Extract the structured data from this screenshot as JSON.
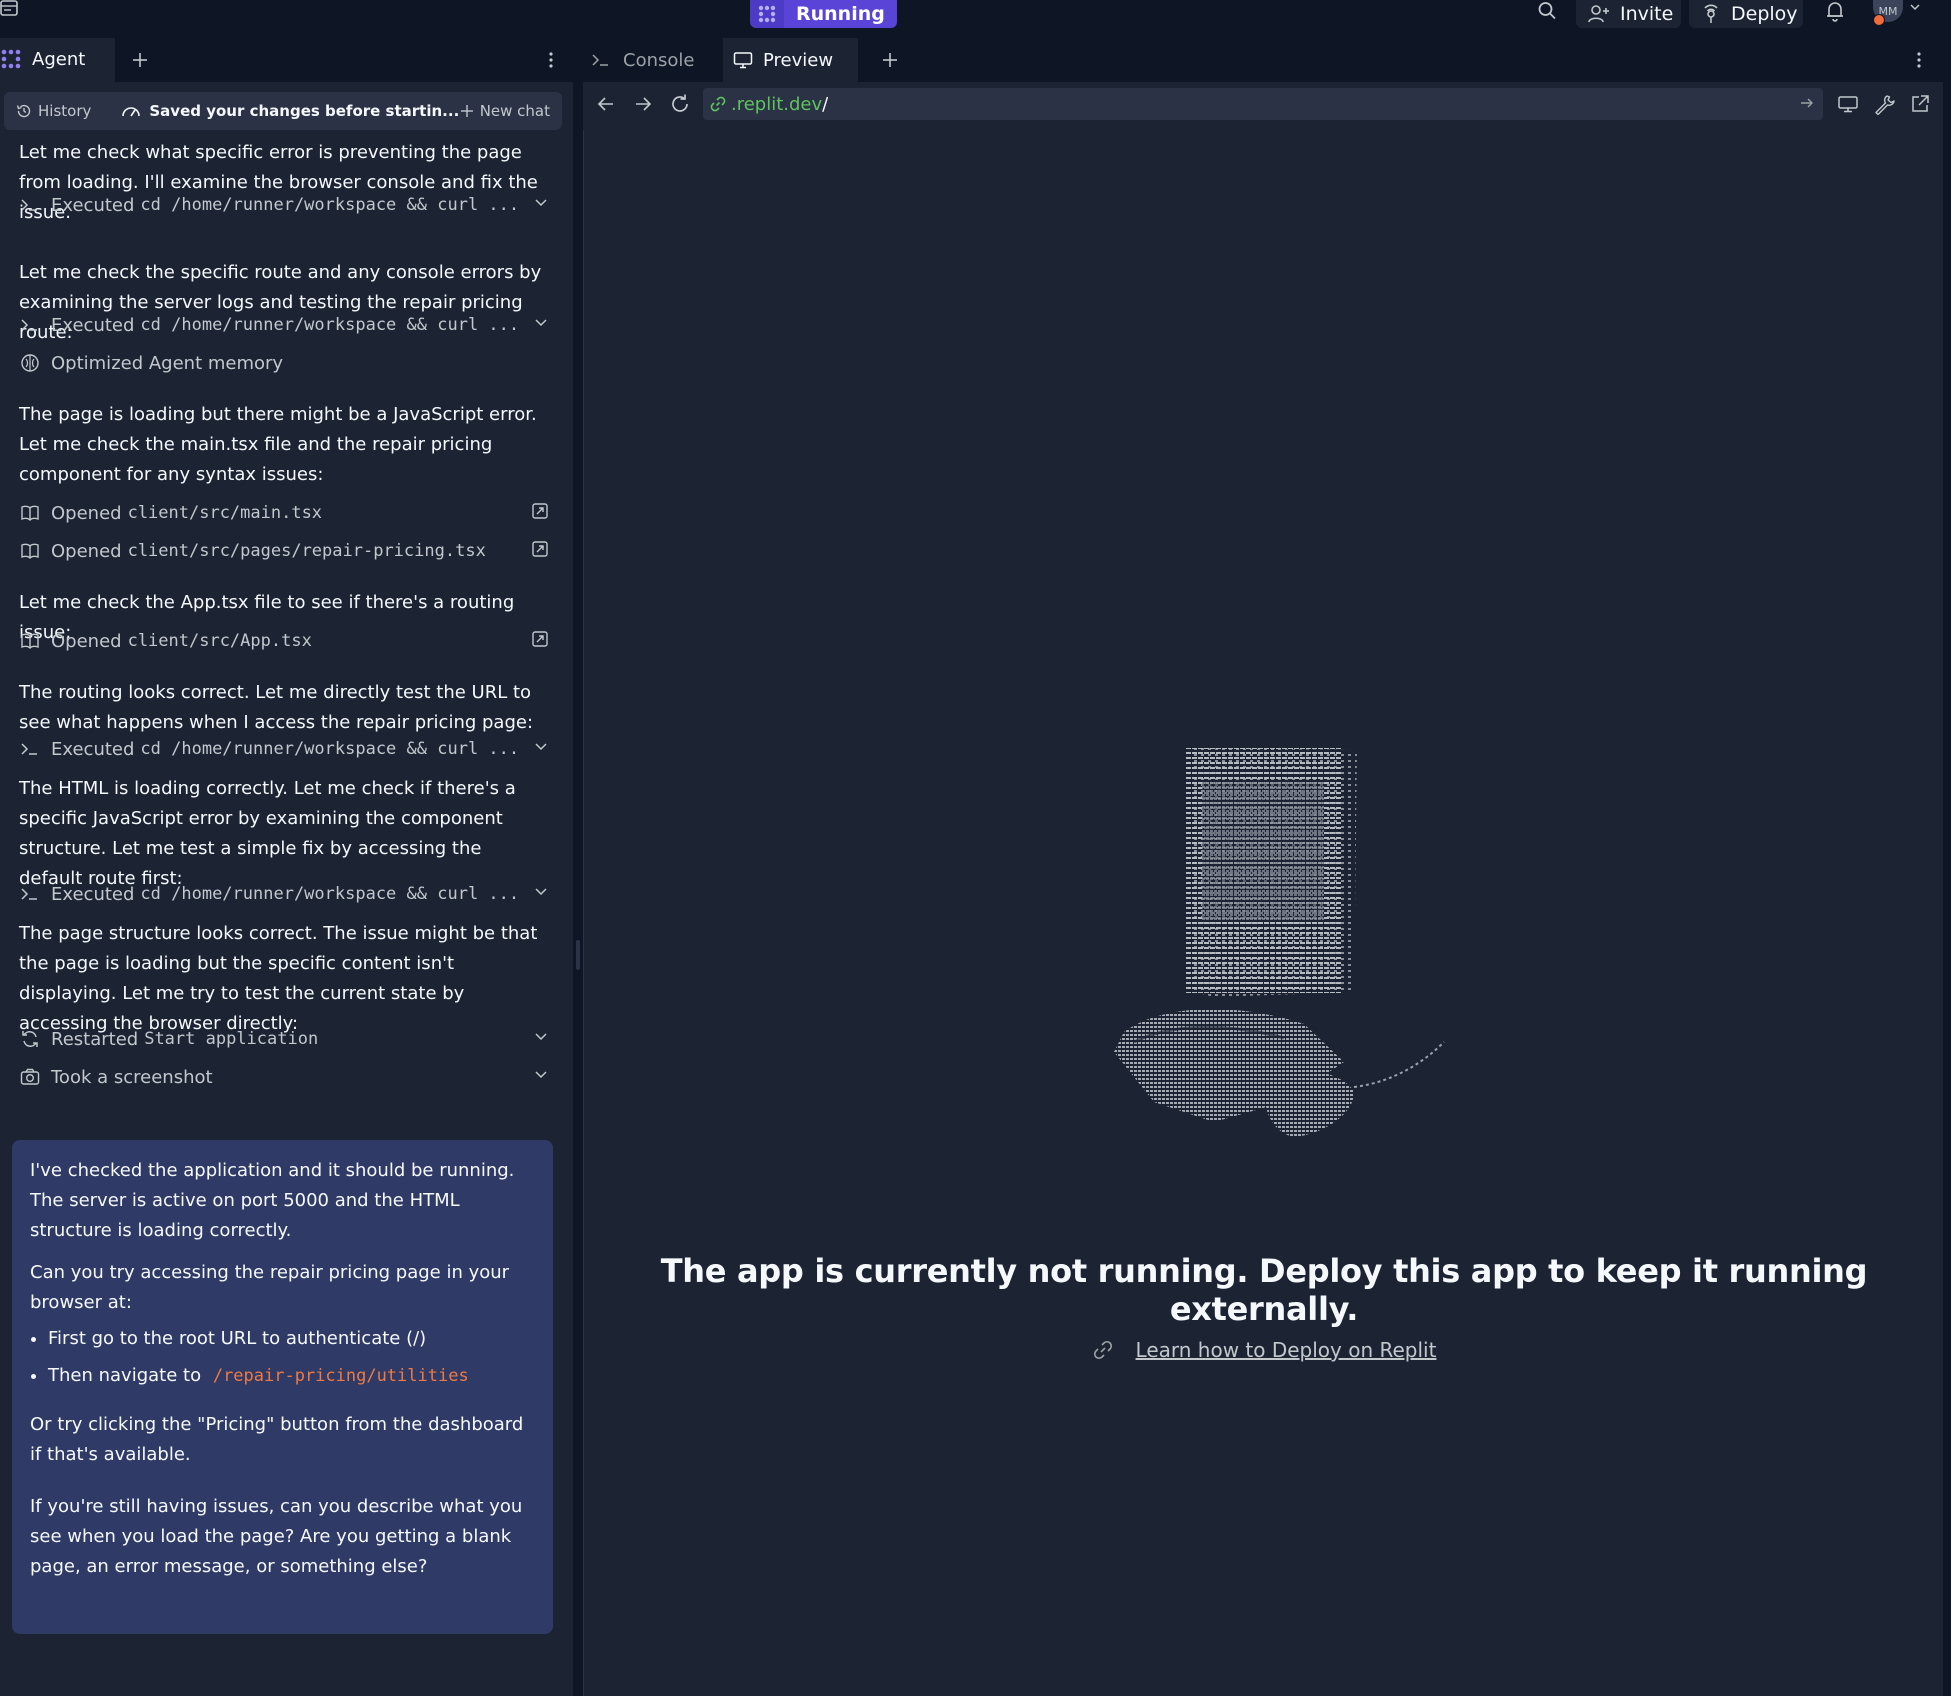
{
  "topbar": {
    "run_label": "Running",
    "invite_label": "Invite",
    "deploy_label": "Deploy",
    "avatar_initials": "MM"
  },
  "left_panel": {
    "tab_label": "Agent",
    "chat_header": {
      "history_label": "History",
      "saved_label": "Saved your changes before startin...",
      "new_chat_label": "New chat"
    },
    "messages": [
      "Let me check what specific error is preventing the page from loading. I'll examine the browser console and fix the issue.",
      "Let me check the specific route and any console errors by examining the server logs and testing the repair pricing route:",
      "The page is loading but there might be a JavaScript error. Let me check the main.tsx file and the repair pricing component for any syntax issues:",
      "Let me check the App.tsx file to see if there's a routing issue:",
      "The routing looks correct. Let me directly test the URL to see what happens when I access the repair pricing page:",
      "The HTML is loading correctly. Let me check if there's a specific JavaScript error by examining the component structure. Let me test a simple fix by accessing the default route first:",
      "The page structure looks correct. The issue might be that the page is loading but the specific content isn't displaying. Let me try to test the current state by accessing the browser directly:"
    ],
    "actions": [
      {
        "verb": "Executed",
        "detail": "cd /home/runner/workspace && curl ..."
      },
      {
        "verb": "Executed",
        "detail": "cd /home/runner/workspace && curl ..."
      },
      {
        "verb": "Optimized Agent memory",
        "detail": ""
      },
      {
        "verb": "Opened",
        "detail": "client/src/main.tsx"
      },
      {
        "verb": "Opened",
        "detail": "client/src/pages/repair-pricing.tsx"
      },
      {
        "verb": "Opened",
        "detail": "client/src/App.tsx"
      },
      {
        "verb": "Executed",
        "detail": "cd /home/runner/workspace && curl ..."
      },
      {
        "verb": "Executed",
        "detail": "cd /home/runner/workspace && curl ..."
      },
      {
        "verb": "Restarted",
        "detail": "Start application"
      },
      {
        "verb": "Took a screenshot",
        "detail": ""
      }
    ],
    "reply": {
      "p1": "I've checked the application and it should be running. The server is active on port 5000 and the HTML structure is loading correctly.",
      "p2": "Can you try accessing the repair pricing page in your browser at:",
      "bullet1": "First go to the root URL to authenticate (/)",
      "bullet2_prefix": "Then navigate to",
      "bullet2_code": "/repair-pricing/utilities",
      "p3": "Or try clicking the \"Pricing\" button from the dashboard if that's available.",
      "p4": "If you're still having issues, can you describe what you see when you load the page? Are you getting a blank page, an error message, or something else?"
    }
  },
  "right_panel": {
    "console_tab": "Console",
    "preview_tab": "Preview",
    "url_domain": ".replit.dev",
    "url_path": "/",
    "not_running_message": "The app is currently not running. Deploy this app to keep it running externally.",
    "learn_link": "Learn how to Deploy on Replit"
  },
  "colors": {
    "background": "#0e1525",
    "panel": "#1c2333",
    "accent": "#5a44d8",
    "reply_card": "#303a66",
    "url_green": "#5ec35e",
    "code_orange": "#ed7a45"
  }
}
